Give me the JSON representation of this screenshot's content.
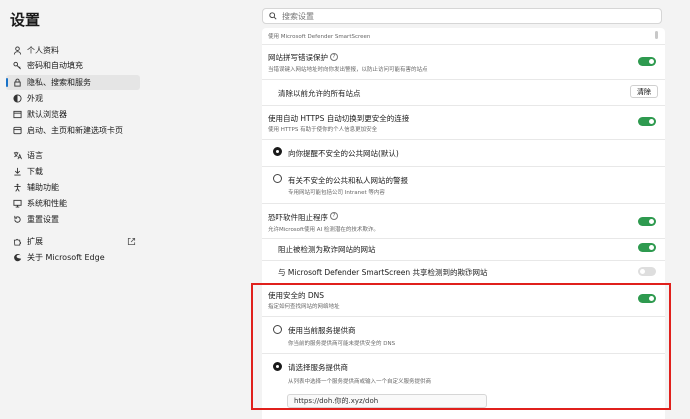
{
  "app_title": "设置",
  "search": {
    "placeholder": "搜索设置"
  },
  "sidebar": {
    "items": [
      {
        "label": "个人资料",
        "icon": "person-icon"
      },
      {
        "label": "密码和自动填充",
        "icon": "key-icon"
      },
      {
        "label": "隐私、搜索和服务",
        "icon": "lock-icon",
        "active": true
      },
      {
        "label": "外观",
        "icon": "appearance-icon"
      },
      {
        "label": "默认浏览器",
        "icon": "browser-icon"
      },
      {
        "label": "启动、主页和新建选项卡页",
        "icon": "home-icon"
      },
      {
        "label": "语言",
        "icon": "language-icon"
      },
      {
        "label": "下载",
        "icon": "download-icon"
      },
      {
        "label": "辅助功能",
        "icon": "accessibility-icon"
      },
      {
        "label": "系统和性能",
        "icon": "system-icon"
      },
      {
        "label": "重置设置",
        "icon": "reset-icon"
      },
      {
        "label": "扩展",
        "icon": "extensions-icon"
      },
      {
        "label": "关于 Microsoft Edge",
        "icon": "edge-icon"
      }
    ]
  },
  "content": {
    "top_desc": "使用 Microsoft Defender SmartScreen",
    "typo": {
      "title": "网站拼写错误保护",
      "desc": "当错误键入网站地址时向你发出警报，以防止访问可能有害的站点",
      "enabled": true,
      "clear_label": "清除以前允许的所有站点",
      "clear_button": "清除"
    },
    "https": {
      "title": "使用自动 HTTPS 自动切换到更安全的连接",
      "desc": "使用 HTTPS 有助于使你的个人信息更加安全",
      "enabled": true,
      "option1": "向你提醒不安全的公共网站(默认)",
      "option2": "有关不安全的公共和私人网站的警报",
      "option2_desc": "专用网站可能包括公司 Intranet 等内容"
    },
    "pua": {
      "title": "恐吓软件阻止程序",
      "desc": "允许Microsoft使用 AI 检测潜在的技术欺诈。",
      "enabled": true,
      "sub1": "阻止被检测为欺诈网站的网站",
      "sub2": "与 Microsoft Defender SmartScreen 共享检测到的欺诈网站"
    },
    "dns": {
      "title": "使用安全的 DNS",
      "desc": "指定如何查找网站的网络地址",
      "enabled": true,
      "option1": "使用当前服务提供商",
      "option1_desc": "你当前的服务提供商可能未提供安全的 DNS",
      "option2": "请选择服务提供商",
      "option2_desc": "从列表中选择一个服务提供商或输入一个自定义服务提供商",
      "provider_value": "https://doh.你的.xyz/doh"
    }
  },
  "colors": {
    "accent": "#2e9a4f",
    "highlight": "#e0201c",
    "active_nav": "#1a73c8"
  }
}
